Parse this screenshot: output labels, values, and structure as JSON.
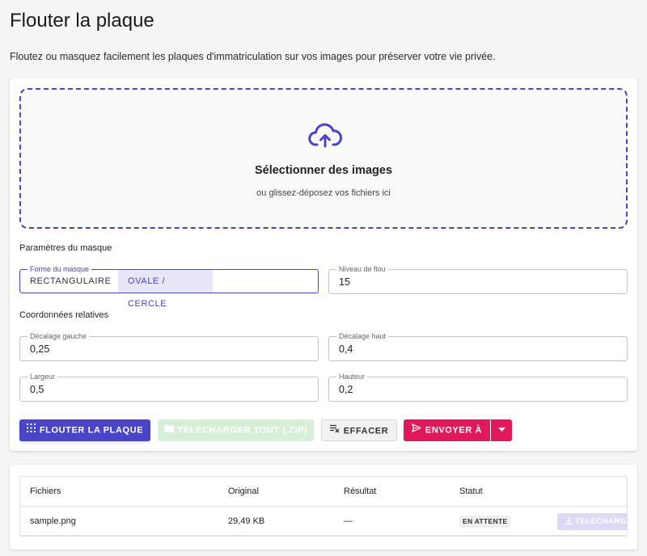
{
  "page": {
    "title": "Flouter la plaque",
    "subtitle": "Floutez ou masquez facilement les plaques d'immatriculation sur vos images pour préserver votre vie privée."
  },
  "dropzone": {
    "icon": "cloud-upload-icon",
    "title": "Sélectionner des images",
    "subtitle": "ou glissez-déposez vos fichiers ici"
  },
  "mask": {
    "section_label": "Paramètres du masque",
    "shape_label": "Forme du masque",
    "shape_options": [
      "RECTANGULAIRE",
      "OVALE / CERCLE"
    ],
    "shape_selected": "OVALE / CERCLE",
    "blur_label": "Niveau de flou",
    "blur_value": "15"
  },
  "coords": {
    "section_label": "Coordonnées relatives",
    "left_label": "Décalage gauche",
    "left_value": "0,25",
    "top_label": "Décalage haut",
    "top_value": "0,4",
    "width_label": "Largeur",
    "width_value": "0,5",
    "height_label": "Hauteur",
    "height_value": "0,2"
  },
  "actions": {
    "blur": "FLOUTER LA PLAQUE",
    "download_all": "TÉLÉCHARGER TOUT (.ZIP)",
    "clear": "EFFACER",
    "send": "ENVOYER À"
  },
  "table": {
    "headers": [
      "Fichiers",
      "Original",
      "Résultat",
      "Statut"
    ],
    "rows": [
      {
        "file": "sample.png",
        "original": "29,49 KB",
        "result": "—",
        "status": "EN ATTENTE",
        "action": "TÉLÉCHARGER"
      }
    ]
  },
  "colors": {
    "primary": "#4a44c6",
    "send": "#e0185c",
    "disabled_green": "#d6efd9"
  }
}
